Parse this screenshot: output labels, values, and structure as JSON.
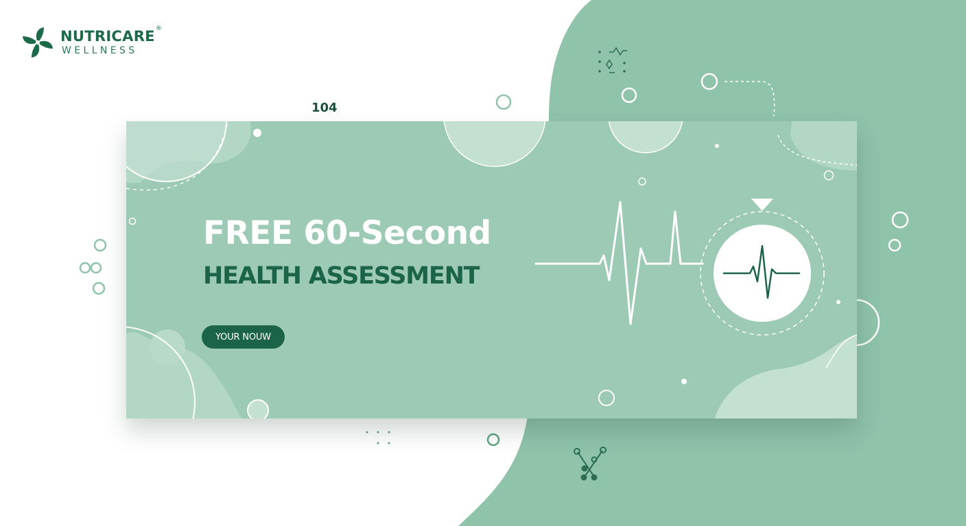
{
  "brand": {
    "name": "NUTRICARE",
    "registered_mark": "®",
    "tagline": "WELLNESS",
    "logo_icon": "pinwheel-leaf-icon"
  },
  "page_number": "104",
  "banner": {
    "headline": "FREE 60-Second",
    "subheadline": "HEALTH ASSESSMENT",
    "cta_label": "YOUR NOUW",
    "icon": "heartbeat-icon"
  },
  "colors": {
    "brand_green": "#1b6449",
    "banner_mint": "#9ccab4",
    "background_mint": "#8fc3aa",
    "light_mint": "#c8e3d5"
  }
}
